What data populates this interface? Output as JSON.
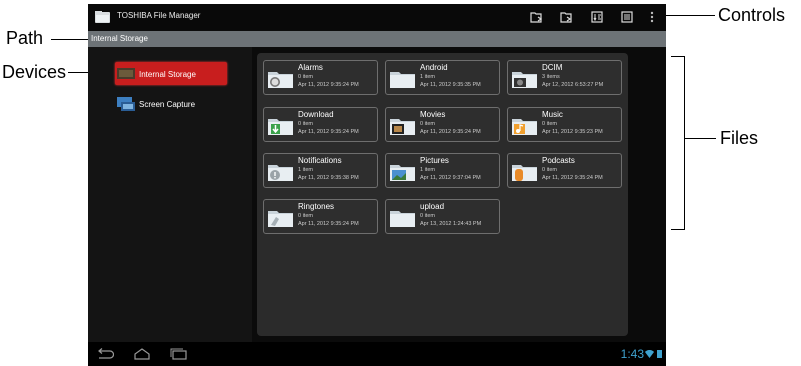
{
  "callouts": {
    "path": "Path",
    "devices": "Devices",
    "controls": "Controls",
    "files": "Files"
  },
  "app": {
    "title": "TOSHIBA File Manager"
  },
  "toolbar": {
    "icons": [
      "new-file-icon",
      "paste-file-icon",
      "sort-icon",
      "list-view-icon",
      "overflow-menu-icon"
    ]
  },
  "path": {
    "text": "Internal Storage"
  },
  "devices": [
    {
      "label": "Internal Storage",
      "icon": "storage-icon",
      "selected": true
    },
    {
      "label": "Screen Capture",
      "icon": "screen-capture-icon",
      "selected": false
    }
  ],
  "folders": [
    {
      "name": "Alarms",
      "count": "0 item",
      "date": "Apr 11, 2012 9:35:24 PM",
      "icon": "alarm-folder-icon"
    },
    {
      "name": "Android",
      "count": "1 item",
      "date": "Apr 11, 2012 9:35:35 PM",
      "icon": "folder-icon"
    },
    {
      "name": "DCIM",
      "count": "3 items",
      "date": "Apr 12, 2012 6:53:27 PM",
      "icon": "camera-folder-icon"
    },
    {
      "name": "Download",
      "count": "0 item",
      "date": "Apr 11, 2012 9:35:24 PM",
      "icon": "download-folder-icon"
    },
    {
      "name": "Movies",
      "count": "0 item",
      "date": "Apr 11, 2012 9:35:24 PM",
      "icon": "movie-folder-icon"
    },
    {
      "name": "Music",
      "count": "0 item",
      "date": "Apr 11, 2012 9:35:23 PM",
      "icon": "music-folder-icon"
    },
    {
      "name": "Notifications",
      "count": "1 item",
      "date": "Apr 11, 2012 9:35:38 PM",
      "icon": "notification-folder-icon"
    },
    {
      "name": "Pictures",
      "count": "1 item",
      "date": "Apr 11, 2012 9:37:04 PM",
      "icon": "picture-folder-icon"
    },
    {
      "name": "Podcasts",
      "count": "0 item",
      "date": "Apr 11, 2012 9:35:24 PM",
      "icon": "podcast-folder-icon"
    },
    {
      "name": "Ringtones",
      "count": "0 item",
      "date": "Apr 11, 2012 9:35:24 PM",
      "icon": "ringtone-folder-icon"
    },
    {
      "name": "upload",
      "count": "0 item",
      "date": "Apr 13, 2012 1:24:43 PM",
      "icon": "folder-icon"
    }
  ],
  "status": {
    "time": "1:43",
    "accent": "#3fa2cf"
  },
  "nav": {
    "icons": [
      "back-icon",
      "home-icon",
      "recent-apps-icon"
    ]
  }
}
